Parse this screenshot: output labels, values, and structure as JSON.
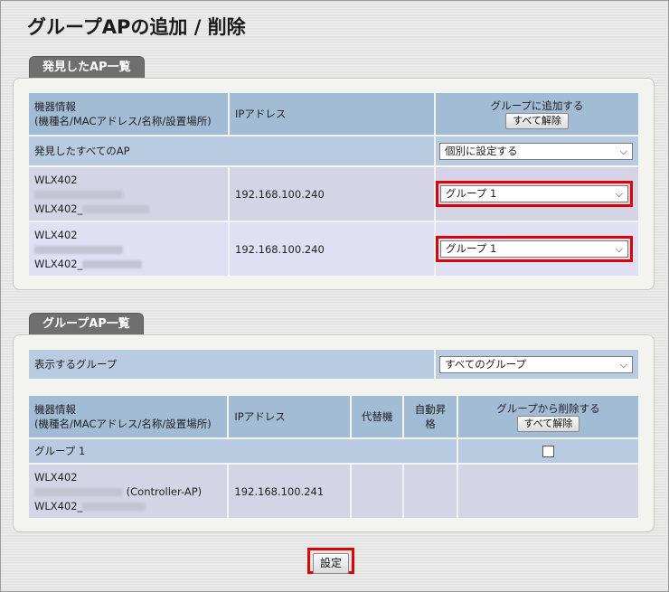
{
  "page": {
    "title": "グループAPの追加 / 削除"
  },
  "discovered": {
    "section_title": "発見したAP一覧",
    "col_device": "機器情報",
    "col_device_sub": "(機種名/MACアドレス/名称/設置場所)",
    "col_ip": "IPアドレス",
    "col_add": "グループに追加する",
    "clear_all_label": "すべて解除",
    "all_row_label": "発見したすべてのAP",
    "all_row_select": "個別に設定する",
    "rows": [
      {
        "model": "WLX402",
        "name_prefix": "WLX402_",
        "ip": "192.168.100.240",
        "group": "グループ 1"
      },
      {
        "model": "WLX402",
        "name_prefix": "WLX402_",
        "ip": "192.168.100.240",
        "group": "グループ 1"
      }
    ]
  },
  "group_list": {
    "section_title": "グループAP一覧",
    "filter_label": "表示するグループ",
    "filter_value": "すべてのグループ",
    "col_device": "機器情報",
    "col_device_sub": "(機種名/MACアドレス/名称/設置場所)",
    "col_ip": "IPアドレス",
    "col_alt": "代替機",
    "col_auto": "自動昇格",
    "col_remove": "グループから削除する",
    "clear_all_label": "すべて解除",
    "group_name": "グループ 1",
    "rows": [
      {
        "model": "WLX402",
        "role": "(Controller-AP)",
        "name_prefix": "WLX402_",
        "ip": "192.168.100.241"
      }
    ]
  },
  "footer": {
    "submit_label": "設定"
  },
  "icons": {
    "dropdown": "chevron-down-icon",
    "checkbox": "checkbox-icon"
  }
}
